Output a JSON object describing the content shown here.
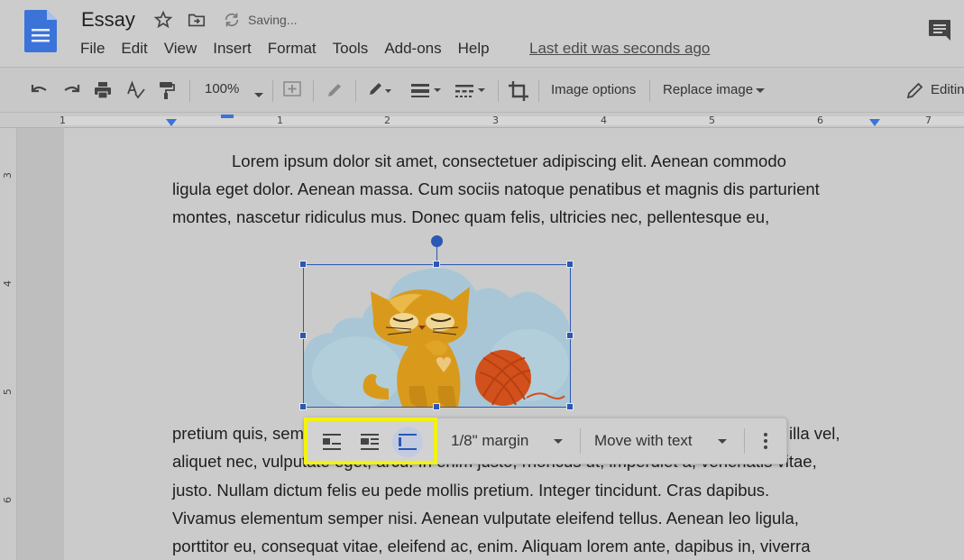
{
  "header": {
    "title": "Essay",
    "status": "Saving...",
    "menu": [
      "File",
      "Edit",
      "View",
      "Insert",
      "Format",
      "Tools",
      "Add-ons",
      "Help"
    ],
    "last_edit": "Last edit was seconds ago"
  },
  "toolbar": {
    "zoom": "100%",
    "image_options": "Image options",
    "replace_image": "Replace image",
    "editing": "Editing"
  },
  "ruler": {
    "numbers": [
      "1",
      "1",
      "2",
      "3",
      "4",
      "5",
      "6",
      "7"
    ],
    "vertical_numbers": [
      "3",
      "4",
      "5",
      "6"
    ]
  },
  "document": {
    "lines_top": [
      "Lorem ipsum dolor sit amet, consectetuer adipiscing elit. Aenean commodo",
      "ligula eget dolor. Aenean massa. Cum sociis natoque penatibus et magnis dis parturient",
      "montes, nascetur ridiculus mus. Donec quam felis, ultricies nec, pellentesque eu,"
    ],
    "line_partial_left": "pretium quis, sem",
    "line_partial_right": "illa vel,",
    "line_obscured": "aliquet nec, vulputate eget, arcu. In enim justo, rhoncus ut, imperdiet a, venenatis vitae,",
    "lines_bottom": [
      "justo. Nullam dictum felis eu pede mollis pretium. Integer tincidunt. Cras dapibus.",
      "Vivamus elementum semper nisi. Aenean vulputate eleifend tellus. Aenean leo ligula,",
      "porttitor eu, consequat vitae, eleifend ac, enim. Aliquam lorem ante, dapibus in, viverra"
    ]
  },
  "image_toolbar": {
    "margin": "1/8\" margin",
    "position": "Move with text"
  },
  "colors": {
    "selection": "#2b57b5",
    "highlight": "#f3f30c",
    "docs_blue": "#3b73d9",
    "cat": "#d99a1c",
    "yarn": "#d2501b",
    "cloud": "#a9c6d6"
  }
}
